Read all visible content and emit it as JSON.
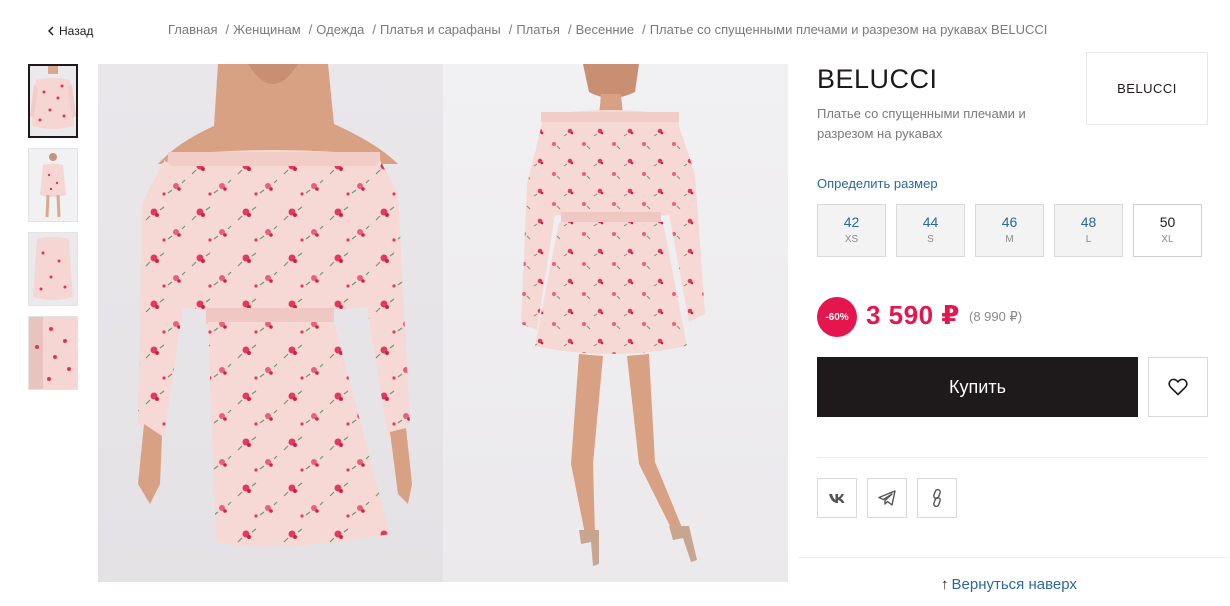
{
  "nav": {
    "back_label": "Назад",
    "breadcrumbs": [
      "Главная",
      "Женщинам",
      "Одежда",
      "Платья и сарафаны",
      "Платья",
      "Весенние",
      "Платье со спущенными плечами и разрезом на рукавах BELUCCI"
    ],
    "separator": "/"
  },
  "gallery": {
    "thumbnail_count": 4,
    "active_thumbnail": 1,
    "main_images": [
      "dress-front-closeup",
      "dress-full-length"
    ]
  },
  "product": {
    "brand": "BELUCCI",
    "title": "Платье со спущенными плечами и разрезом на рукавах",
    "brand_logo_text": "BELUCCI",
    "size_guide_label": "Определить размер",
    "sizes": [
      {
        "num": "42",
        "label": "XS"
      },
      {
        "num": "44",
        "label": "S"
      },
      {
        "num": "46",
        "label": "M"
      },
      {
        "num": "48",
        "label": "L"
      },
      {
        "num": "50",
        "label": "XL"
      }
    ],
    "selected_size": "50",
    "discount": "-60%",
    "price": "3 590 ₽",
    "old_price": "(8 990 ₽)",
    "buy_label": "Купить",
    "favorite_icon": "heart-icon",
    "share_icons": [
      "vk-icon",
      "telegram-icon",
      "link-icon"
    ],
    "back_to_top_label": "Вернуться наверх"
  },
  "colors": {
    "accent": "#e5164e",
    "link": "#2a6a9a",
    "dark": "#1e1a1b",
    "dress": "#f5d6d2"
  }
}
